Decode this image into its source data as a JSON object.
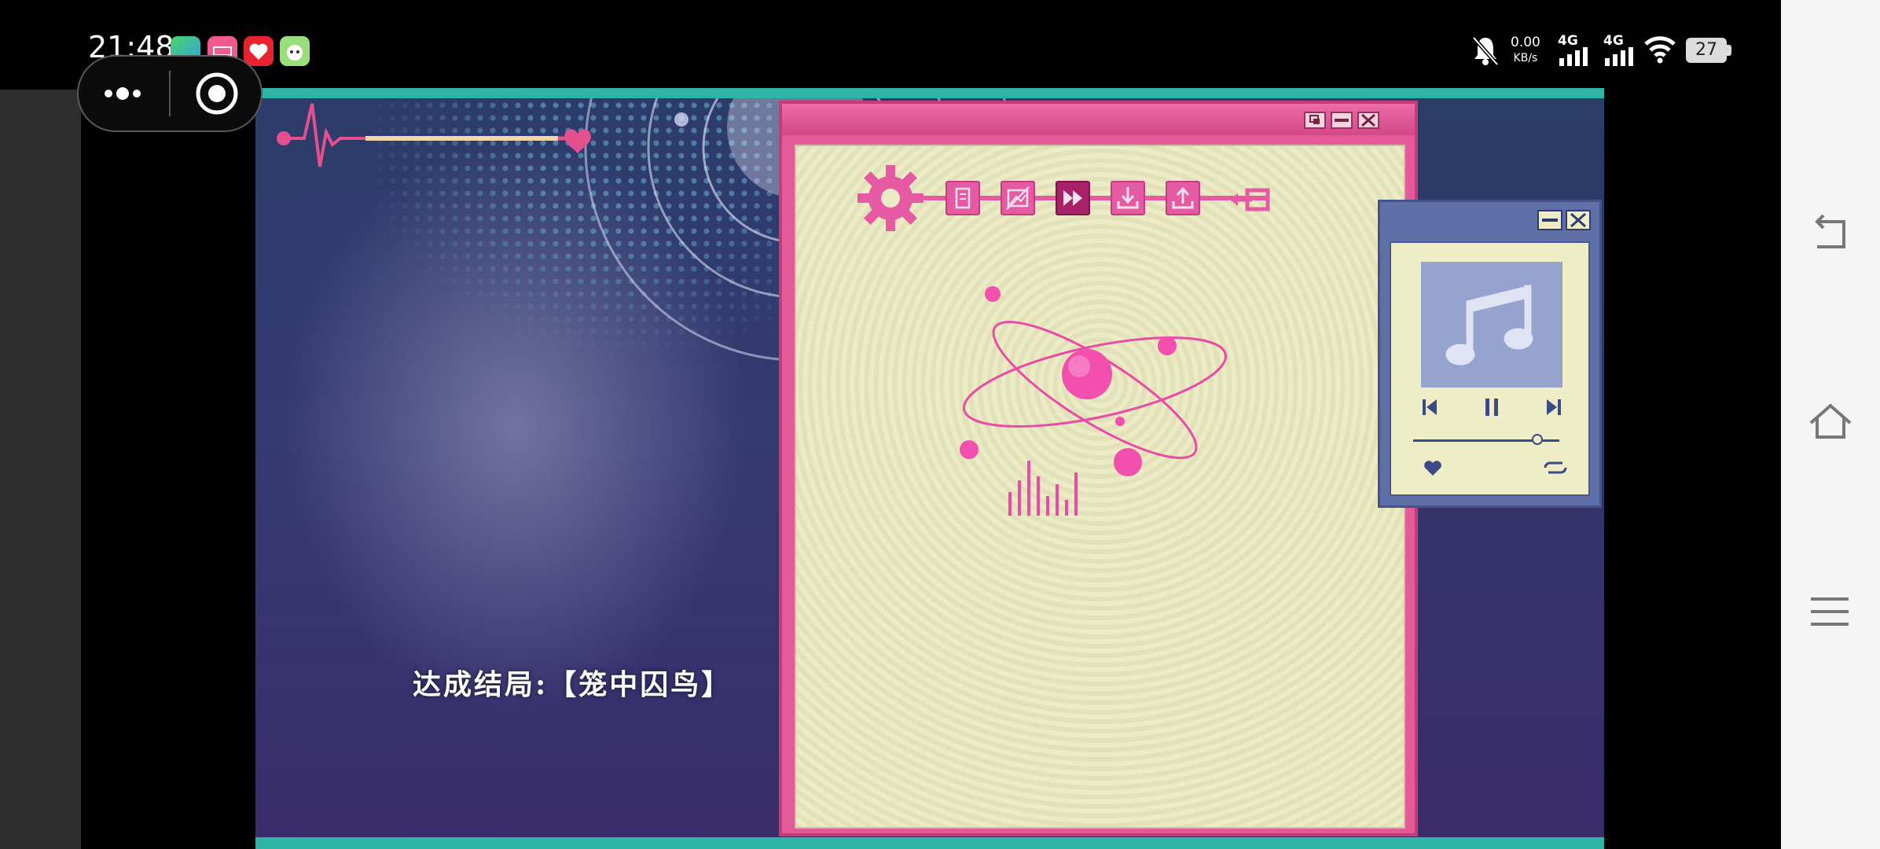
{
  "status_bar": {
    "time": "21:48",
    "net_speed_value": "0.00",
    "net_speed_unit": "KB/s",
    "signal_1": "4G",
    "signal_2": "4G",
    "battery": "27",
    "icons": [
      "mute-bell-icon",
      "signal-bars-icon",
      "signal-bars-icon",
      "wifi-icon",
      "battery-icon"
    ]
  },
  "notification_apps": [
    "app-icon-green",
    "app-icon-pink",
    "app-icon-red",
    "app-icon-cartoon"
  ],
  "capsule": {
    "menu_icon": "more-dots-icon",
    "close_icon": "target-close-icon"
  },
  "game": {
    "ending_text": "达成结局:【笼中囚鸟】",
    "toolbar": [
      {
        "name": "settings",
        "icon": "gear-icon",
        "active": false
      },
      {
        "name": "log",
        "icon": "notebook-icon",
        "active": false
      },
      {
        "name": "hide-ui",
        "icon": "hide-image-icon",
        "active": false
      },
      {
        "name": "skip",
        "icon": "fast-forward-icon",
        "active": true
      },
      {
        "name": "save",
        "icon": "download-icon",
        "active": false
      },
      {
        "name": "load",
        "icon": "upload-icon",
        "active": false
      },
      {
        "name": "exit",
        "icon": "exit-arrow-icon",
        "active": false
      }
    ],
    "main_window_buttons": [
      "restore-icon",
      "minimize-icon",
      "close-icon"
    ],
    "music_player": {
      "window_buttons": [
        "minimize-icon",
        "close-icon"
      ],
      "controls": [
        "previous-track-icon",
        "pause-icon",
        "next-track-icon"
      ],
      "progress": 0.85,
      "bottom_icons": [
        "heart-icon",
        "loop-icon"
      ]
    },
    "colors": {
      "accent_pink": "#e45a98",
      "paper": "#ecebc6",
      "teal": "#2fb3a5",
      "player_blue": "#5f70a8"
    }
  },
  "nav_bar": {
    "icons": [
      "back-icon",
      "home-icon",
      "menu-icon"
    ]
  }
}
